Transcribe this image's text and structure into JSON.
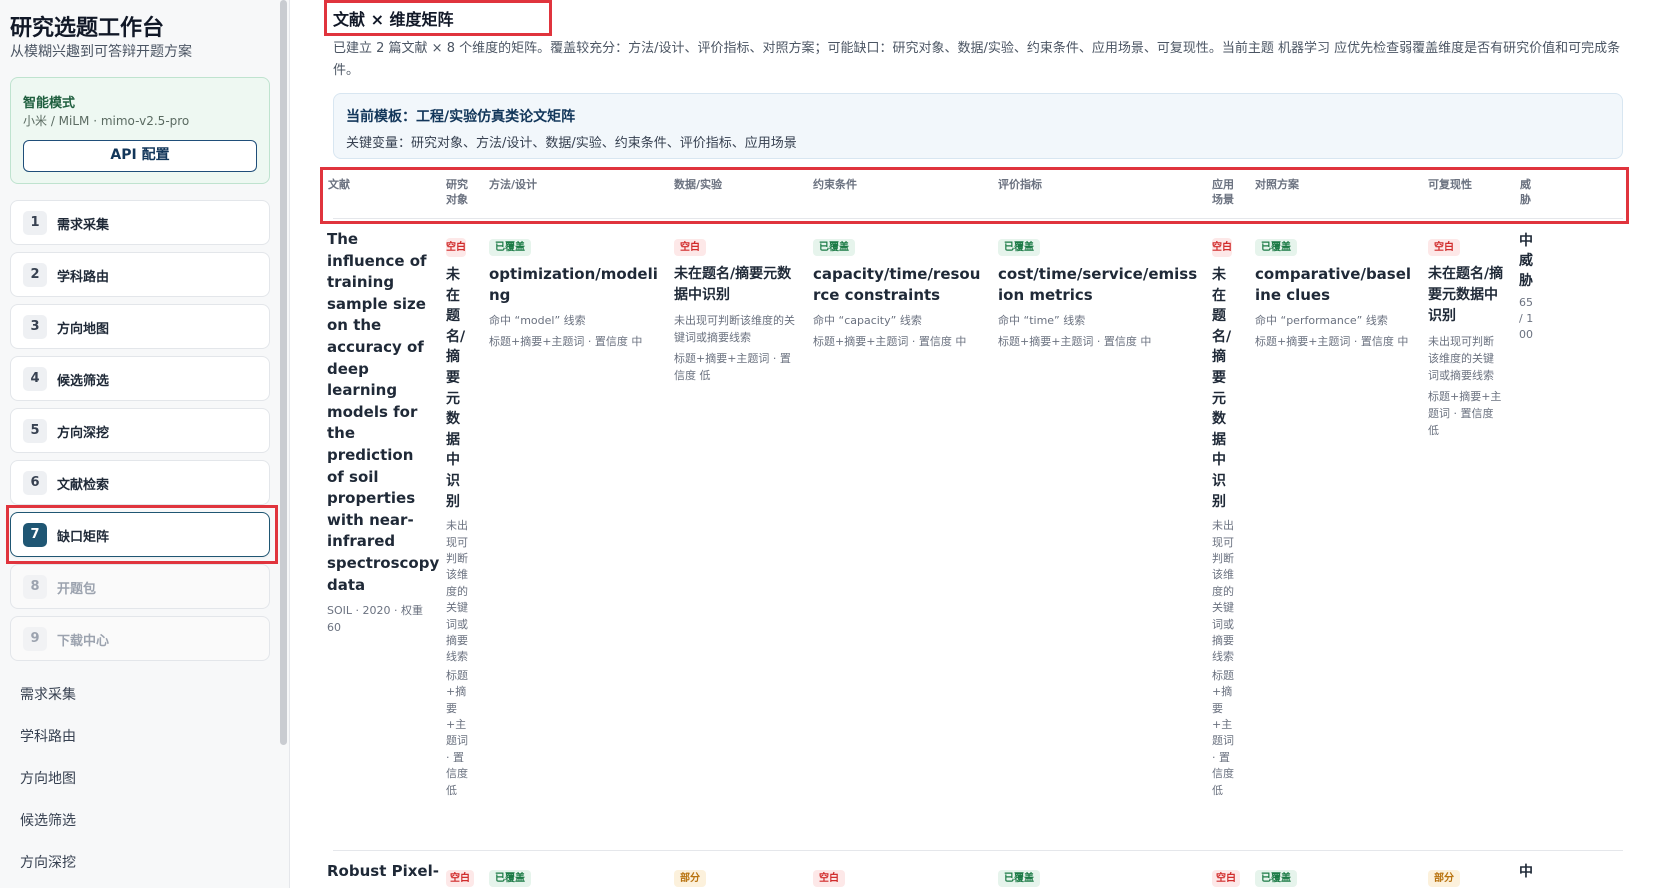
{
  "sidebar": {
    "brand_title": "研究选题工作台",
    "brand_subtitle": "从模糊兴趣到可答辩开题方案",
    "mode": {
      "title": "智能模式",
      "model": "小米 / MiLM · mimo-v2.5-pro",
      "api_button": "API 配置"
    },
    "steps": [
      {
        "num": "1",
        "label": "需求采集",
        "state": "normal"
      },
      {
        "num": "2",
        "label": "学科路由",
        "state": "normal"
      },
      {
        "num": "3",
        "label": "方向地图",
        "state": "normal"
      },
      {
        "num": "4",
        "label": "候选筛选",
        "state": "normal"
      },
      {
        "num": "5",
        "label": "方向深挖",
        "state": "normal"
      },
      {
        "num": "6",
        "label": "文献检索",
        "state": "normal"
      },
      {
        "num": "7",
        "label": "缺口矩阵",
        "state": "active"
      },
      {
        "num": "8",
        "label": "开题包",
        "state": "disabled"
      },
      {
        "num": "9",
        "label": "下载中心",
        "state": "disabled"
      }
    ],
    "nav_links": [
      "需求采集",
      "学科路由",
      "方向地图",
      "候选筛选",
      "方向深挖"
    ]
  },
  "main": {
    "title": "文献 × 维度矩阵",
    "summary": "已建立 2 篇文献 × 8 个维度的矩阵。覆盖较充分：方法/设计、评价指标、对照方案；可能缺口：研究对象、数据/实验、约束条件、应用场景、可复现性。当前主题 机器学习 应优先检查弱覆盖维度是否有研究价值和可完成条件。",
    "template": {
      "title": "当前模板：工程/实验仿真类论文矩阵",
      "variables": "关键变量：研究对象、方法/设计、数据/实验、约束条件、评价指标、应用场景"
    },
    "columns": [
      "文献",
      "研究对象",
      "方法/设计",
      "数据/实验",
      "约束条件",
      "评价指标",
      "应用场景",
      "对照方案",
      "可复现性",
      "威胁"
    ],
    "rows": [
      {
        "title": "The influence of training sample size on the accuracy of deep learning models for the prediction of soil properties with near-infrared spectroscopy data",
        "meta": "SOIL · 2020 · 权重 60",
        "cells": {
          "subject": {
            "badge": "空白",
            "title": "未在题名/摘要元数据中识别",
            "note": "未出现可判断该维度的关键词或摘要线索",
            "source": "标题+摘要+主题词 · 置信度 低"
          },
          "method": {
            "badge": "已覆盖",
            "title": "optimization/modeling",
            "hit": "命中 “model” 线索",
            "source": "标题+摘要+主题词 · 置信度 中"
          },
          "data": {
            "badge": "空白",
            "title": "未在题名/摘要元数据中识别",
            "note": "未出现可判断该维度的关键词或摘要线索",
            "source": "标题+摘要+主题词 · 置信度 低"
          },
          "constraint": {
            "badge": "已覆盖",
            "title": "capacity/time/resource constraints",
            "hit": "命中 “capacity” 线索",
            "source": "标题+摘要+主题词 · 置信度 中"
          },
          "metric": {
            "badge": "已覆盖",
            "title": "cost/time/service/emission metrics",
            "hit": "命中 “time” 线索",
            "source": "标题+摘要+主题词 · 置信度 中"
          },
          "scenario": {
            "badge": "空白",
            "title": "未在题名/摘要元数据中识别",
            "note": "未出现可判断该维度的关键词或摘要线索",
            "source": "标题+摘要+主题词 · 置信度 低"
          },
          "baseline": {
            "badge": "已覆盖",
            "title": "comparative/baseline clues",
            "hit": "命中 “performance” 线索",
            "source": "标题+摘要+主题词 · 置信度 中"
          },
          "repro": {
            "badge": "空白",
            "title": "未在题名/摘要元数据中识别",
            "note": "未出现可判断该维度的关键词或摘要线索",
            "source": "标题+摘要+主题词 · 置信度 低"
          },
          "threat": {
            "level": "中威胁",
            "score": "65 / 100"
          }
        }
      },
      {
        "title": "Robust Pixel-",
        "badges": {
          "subject": "空白",
          "method": "已覆盖",
          "data": "部分",
          "constraint": "空白",
          "metric": "已覆盖",
          "scenario": "空白",
          "baseline": "已覆盖",
          "repro": "部分"
        },
        "threat_level": "中"
      }
    ]
  }
}
